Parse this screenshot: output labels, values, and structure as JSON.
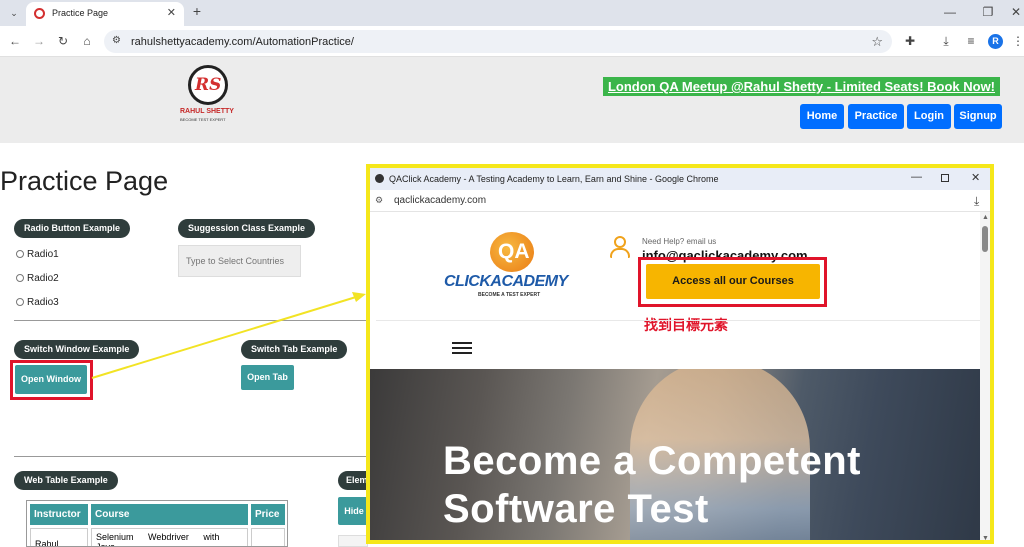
{
  "browser": {
    "tab_title": "Practice Page",
    "new_tab_symbol": "+",
    "url": "rahulshettyacademy.com/AutomationPractice/",
    "profile_initial": "R"
  },
  "header": {
    "logo_text": "RS",
    "logo_name": "RAHUL SHETTY",
    "logo_tagline": "BECOME TEST EXPERT",
    "banner": "London QA Meetup @Rahul Shetty - Limited Seats! Book Now!",
    "nav": [
      "Home",
      "Practice",
      "Login",
      "Signup"
    ]
  },
  "page": {
    "title": "Practice Page",
    "radio_section": {
      "label": "Radio Button Example",
      "options": [
        "Radio1",
        "Radio2",
        "Radio3"
      ]
    },
    "suggestion_section": {
      "label": "Suggession Class Example",
      "placeholder": "Type to Select Countries"
    },
    "switch_window": {
      "label": "Switch Window Example",
      "button": "Open Window"
    },
    "switch_tab": {
      "label": "Switch Tab Example",
      "button": "Open Tab"
    },
    "web_table": {
      "label": "Web Table Example",
      "headers": [
        "Instructor",
        "Course",
        "Price"
      ],
      "row1": {
        "instructor": "Rahul",
        "course": "Selenium Webdriver with Java"
      }
    },
    "element_display": {
      "label_partial": "Elem",
      "button_partial": "Hide"
    }
  },
  "popup": {
    "window_title": "QAClick Academy - A Testing Academy to Learn, Earn and Shine - Google Chrome",
    "url": "qaclickacademy.com",
    "logo_qa": "QA",
    "logo_name": "CLICKACADEMY",
    "logo_tagline": "BECOME A TEST EXPERT",
    "help_label": "Need Help? email us",
    "help_email": "info@qaclickacademy.com",
    "courses_button": "Access all our Courses",
    "annotation": "找到目標元素",
    "hero_line1": "Become a Competent",
    "hero_line2": "Software Test"
  },
  "colors": {
    "banner_bg": "#3bb54a",
    "nav_blue": "#006eff",
    "teal": "#3b9a9c",
    "highlight_red": "#e0142a",
    "popup_border": "#f5e71a",
    "courses_yellow": "#f7b500"
  }
}
